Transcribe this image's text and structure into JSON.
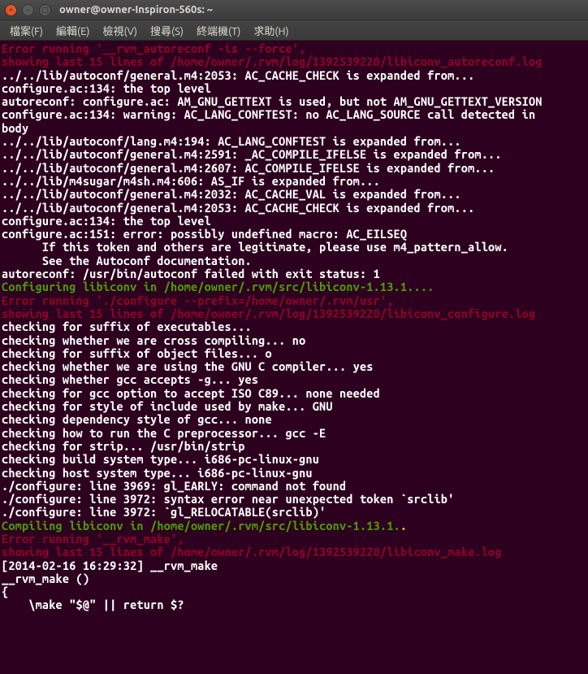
{
  "window": {
    "title": "owner@owner-Inspiron-560s: ~"
  },
  "menubar": {
    "items": [
      "檔案(F)",
      "編輯(E)",
      "檢視(V)",
      "搜尋(S)",
      "終端機(T)",
      "求助(H)"
    ]
  },
  "terminal": {
    "lines": [
      {
        "cls": "c-red-dark",
        "text": "Error running '__rvm_autoreconf -is --force',"
      },
      {
        "cls": "c-red-dark",
        "text": "showing last 15 lines of /home/owner/.rvm/log/1392539220/libiconv_autoreconf.log"
      },
      {
        "cls": "c-white",
        "text": "../../lib/autoconf/general.m4:2053: AC_CACHE_CHECK is expanded from..."
      },
      {
        "cls": "c-white",
        "text": "configure.ac:134: the top level"
      },
      {
        "cls": "c-white",
        "text": "autoreconf: configure.ac: AM_GNU_GETTEXT is used, but not AM_GNU_GETTEXT_VERSION"
      },
      {
        "cls": "c-white",
        "text": "configure.ac:134: warning: AC_LANG_CONFTEST: no AC_LANG_SOURCE call detected in "
      },
      {
        "cls": "c-white",
        "text": "body"
      },
      {
        "cls": "c-white",
        "text": "../../lib/autoconf/lang.m4:194: AC_LANG_CONFTEST is expanded from..."
      },
      {
        "cls": "c-white",
        "text": "../../lib/autoconf/general.m4:2591: _AC_COMPILE_IFELSE is expanded from..."
      },
      {
        "cls": "c-white",
        "text": "../../lib/autoconf/general.m4:2607: AC_COMPILE_IFELSE is expanded from..."
      },
      {
        "cls": "c-white",
        "text": "../../lib/m4sugar/m4sh.m4:606: AS_IF is expanded from..."
      },
      {
        "cls": "c-white",
        "text": "../../lib/autoconf/general.m4:2032: AC_CACHE_VAL is expanded from..."
      },
      {
        "cls": "c-white",
        "text": "../../lib/autoconf/general.m4:2053: AC_CACHE_CHECK is expanded from..."
      },
      {
        "cls": "c-white",
        "text": "configure.ac:134: the top level"
      },
      {
        "cls": "c-white",
        "text": "configure.ac:151: error: possibly undefined macro: AC_EILSEQ"
      },
      {
        "cls": "c-white",
        "text": "      If this token and others are legitimate, please use m4_pattern_allow."
      },
      {
        "cls": "c-white",
        "text": "      See the Autoconf documentation."
      },
      {
        "cls": "c-white",
        "text": "autoreconf: /usr/bin/autoconf failed with exit status: 1"
      },
      {
        "cls": "c-green",
        "text": "Configuring libiconv in /home/owner/.rvm/src/libiconv-1.13.1...."
      },
      {
        "cls": "c-red-dark",
        "text": "Error running './configure --prefix=/home/owner/.rvm/usr',"
      },
      {
        "cls": "c-red-dark",
        "text": "showing last 15 lines of /home/owner/.rvm/log/1392539220/libiconv_configure.log"
      },
      {
        "cls": "c-white",
        "text": "checking for suffix of executables..."
      },
      {
        "cls": "c-white",
        "text": "checking whether we are cross compiling... no"
      },
      {
        "cls": "c-white",
        "text": "checking for suffix of object files... o"
      },
      {
        "cls": "c-white",
        "text": "checking whether we are using the GNU C compiler... yes"
      },
      {
        "cls": "c-white",
        "text": "checking whether gcc accepts -g... yes"
      },
      {
        "cls": "c-white",
        "text": "checking for gcc option to accept ISO C89... none needed"
      },
      {
        "cls": "c-white",
        "text": "checking for style of include used by make... GNU"
      },
      {
        "cls": "c-white",
        "text": "checking dependency style of gcc... none"
      },
      {
        "cls": "c-white",
        "text": "checking how to run the C preprocessor... gcc -E"
      },
      {
        "cls": "c-white",
        "text": "checking for strip... /usr/bin/strip"
      },
      {
        "cls": "c-white",
        "text": "checking build system type... i686-pc-linux-gnu"
      },
      {
        "cls": "c-white",
        "text": "checking host system type... i686-pc-linux-gnu"
      },
      {
        "cls": "c-white",
        "text": "./configure: line 3969: gl_EARLY: command not found"
      },
      {
        "cls": "c-white",
        "text": "./configure: line 3972: syntax error near unexpected token `srclib'"
      },
      {
        "cls": "c-white",
        "text": "./configure: line 3972: `gl_RELOCATABLE(srclib)'"
      },
      {
        "spans": [
          {
            "cls": "c-green",
            "text": "Compiling libiconv in /home/owner/.rvm/src/libiconv-1.13.1."
          },
          {
            "cls": "c-yellow",
            "text": "."
          }
        ]
      },
      {
        "cls": "c-red-dark",
        "text": "Error running '__rvm_make',"
      },
      {
        "cls": "c-red-dark",
        "text": "showing last 15 lines of /home/owner/.rvm/log/1392539220/libiconv_make.log"
      },
      {
        "cls": "c-white",
        "text": "[2014-02-16 16:29:32] __rvm_make"
      },
      {
        "cls": "c-white",
        "text": "__rvm_make ()"
      },
      {
        "cls": "c-white",
        "text": "{"
      },
      {
        "cls": "c-white",
        "text": "    \\make \"$@\" || return $?"
      }
    ]
  }
}
